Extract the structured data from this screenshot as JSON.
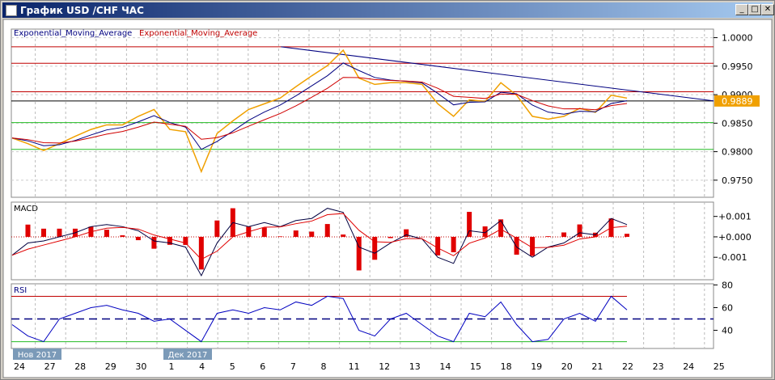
{
  "window": {
    "title": "График USD /CHF  ЧАС",
    "minimize": "_",
    "maximize": "□",
    "close": "✕"
  },
  "legend": {
    "ema1": "Exponential_Moving_Average",
    "ema2": "Exponential_Moving_Average",
    "macd": "MACD",
    "rsi": "RSI"
  },
  "colors": {
    "price": "#f0a000",
    "ema_fast": "#000080",
    "ema_slow": "#d00000",
    "resistance": "#c00000",
    "support": "#22bb22",
    "current": "#000000",
    "trend": "#000080"
  },
  "chart_data": [
    {
      "type": "line",
      "title": "USD/CHF H1",
      "ylim": [
        0.972,
        1.0015
      ],
      "yticks": [
        "1.0000",
        "0.9950",
        "0.9900",
        "0.9850",
        "0.9800",
        "0.9750"
      ],
      "ytick_values": [
        1.0,
        0.995,
        0.99,
        0.985,
        0.98,
        0.975
      ],
      "current_price": "0.9889",
      "current_value": 0.9889,
      "resistance_levels": [
        0.9984,
        0.9955,
        0.9905
      ],
      "support_levels": [
        0.9851,
        0.9804
      ],
      "trendline": {
        "from": [
          8.6,
          0.9984
        ],
        "to": [
          23.0,
          0.9888
        ]
      },
      "price": [
        0.9824,
        0.9814,
        0.9802,
        0.9814,
        0.9827,
        0.9839,
        0.9847,
        0.9847,
        0.9862,
        0.9874,
        0.9839,
        0.9835,
        0.9765,
        0.9832,
        0.9854,
        0.9874,
        0.9884,
        0.9894,
        0.9914,
        0.9933,
        0.9951,
        0.9978,
        0.9929,
        0.9918,
        0.9921,
        0.9921,
        0.9918,
        0.9884,
        0.9862,
        0.9891,
        0.9888,
        0.9921,
        0.9899,
        0.9862,
        0.9857,
        0.9862,
        0.9876,
        0.9869,
        0.9899,
        0.9894
      ]
    },
    {
      "type": "line",
      "title": "MACD",
      "ylim": [
        -0.0021,
        0.0017
      ],
      "yticks": [
        "+0.001",
        "+0.000",
        "-0.001"
      ],
      "ytick_values": [
        0.001,
        0,
        -0.001
      ],
      "macd": [
        -0.0009,
        -0.0003,
        -0.0002,
        0.0,
        0.0002,
        0.0005,
        0.0006,
        0.0005,
        0.0003,
        -0.0002,
        -0.0003,
        -0.0005,
        -0.0019,
        -0.0003,
        0.0007,
        0.0005,
        0.0007,
        0.0005,
        0.0008,
        0.0009,
        0.0014,
        0.0012,
        -0.0005,
        -0.0008,
        -0.0003,
        0.0001,
        -0.0001,
        -0.001,
        -0.0013,
        0.0003,
        0.0002,
        0.0008,
        -0.0005,
        -0.001,
        -0.0005,
        -0.0003,
        0.0002,
        0.0001,
        0.0009,
        0.0006
      ]
    },
    {
      "type": "line",
      "title": "RSI",
      "ylim": [
        24,
        81
      ],
      "yticks": [
        "80",
        "60",
        "40"
      ],
      "ytick_values": [
        80,
        60,
        40
      ],
      "levels": [
        70,
        50,
        30
      ],
      "rsi": [
        45,
        35,
        30,
        50,
        55,
        60,
        62,
        58,
        55,
        48,
        50,
        40,
        30,
        55,
        58,
        55,
        60,
        58,
        65,
        62,
        70,
        68,
        40,
        35,
        50,
        55,
        45,
        35,
        30,
        55,
        52,
        65,
        45,
        30,
        32,
        50,
        55,
        48,
        70,
        58
      ]
    }
  ],
  "xaxis": {
    "labels": [
      "24",
      "27",
      "28",
      "29",
      "30",
      "1",
      "4",
      "5",
      "6",
      "7",
      "8",
      "11",
      "12",
      "13",
      "14",
      "15",
      "18",
      "19",
      "20",
      "21",
      "22",
      "23",
      "24",
      "25"
    ],
    "month_labels": [
      "Нов 2017",
      "Дек 2017"
    ]
  }
}
